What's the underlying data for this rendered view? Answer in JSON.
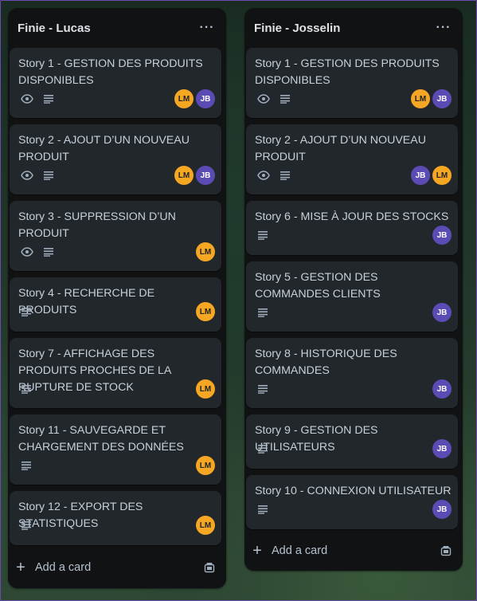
{
  "lists": [
    {
      "title": "Finie - Lucas",
      "add_card_label": "Add a card",
      "cards": [
        {
          "title": "Story 1 - GESTION DES PRODUITS DISPONIBLES",
          "badges": [
            "eye-icon",
            "description-icon"
          ],
          "members": [
            "LM",
            "JB"
          ]
        },
        {
          "title": "Story 2 - AJOUT D’UN NOUVEAU PRODUIT",
          "badges": [
            "eye-icon",
            "description-icon"
          ],
          "members": [
            "LM",
            "JB"
          ]
        },
        {
          "title": "Story 3 - SUPPRESSION D’UN PRODUIT",
          "badges": [
            "eye-icon",
            "description-icon"
          ],
          "members": [
            "LM"
          ]
        },
        {
          "title": "Story 4 - RECHERCHE DE PRODUITS",
          "badges": [
            "description-icon"
          ],
          "members": [
            "LM"
          ]
        },
        {
          "title": "Story 7 - AFFICHAGE DES PRODUITS PROCHES DE LA RUPTURE DE STOCK",
          "badges": [
            "description-icon"
          ],
          "members": [
            "LM"
          ]
        },
        {
          "title": "Story 11 - SAUVEGARDE ET CHARGEMENT DES DONNÉES",
          "badges": [
            "description-icon"
          ],
          "members": [
            "LM"
          ]
        },
        {
          "title": "Story 12 - EXPORT DES STATISTIQUES",
          "badges": [
            "description-icon"
          ],
          "members": [
            "LM"
          ]
        }
      ]
    },
    {
      "title": "Finie - Josselin",
      "add_card_label": "Add a card",
      "cards": [
        {
          "title": "Story 1 - GESTION DES PRODUITS DISPONIBLES",
          "badges": [
            "eye-icon",
            "description-icon"
          ],
          "members": [
            "LM",
            "JB"
          ]
        },
        {
          "title": "Story 2 - AJOUT D’UN NOUVEAU PRODUIT",
          "badges": [
            "eye-icon",
            "description-icon"
          ],
          "members": [
            "JB",
            "LM"
          ]
        },
        {
          "title": "Story 6 - MISE À JOUR DES STOCKS",
          "badges": [
            "description-icon"
          ],
          "members": [
            "JB"
          ]
        },
        {
          "title": "Story 5 - GESTION DES COMMANDES CLIENTS",
          "badges": [
            "description-icon"
          ],
          "members": [
            "JB"
          ]
        },
        {
          "title": "Story 8 - HISTORIQUE DES COMMANDES",
          "badges": [
            "description-icon"
          ],
          "members": [
            "JB"
          ]
        },
        {
          "title": "Story 9 - GESTION DES UTILISATEURS",
          "badges": [
            "description-icon"
          ],
          "members": [
            "JB"
          ]
        },
        {
          "title": "Story 10 - CONNEXION UTILISATEUR",
          "badges": [
            "description-icon"
          ],
          "members": [
            "JB"
          ]
        }
      ]
    }
  ],
  "menu_glyph": "···",
  "colors": {
    "avatar_lm": "#f5a623",
    "avatar_jb": "#5b4bb5",
    "card_bg": "#22272b",
    "list_bg": "#111214"
  }
}
